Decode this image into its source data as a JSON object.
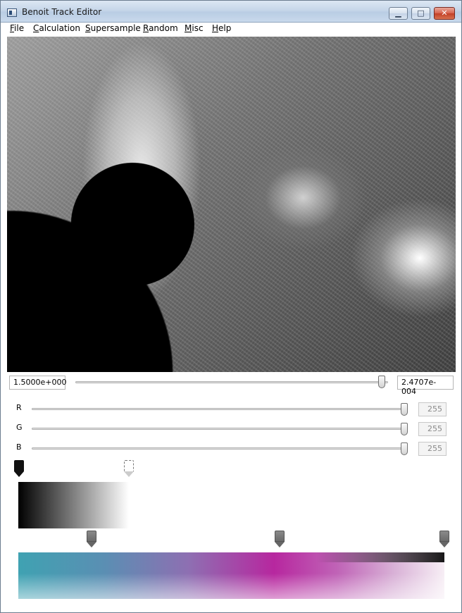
{
  "window": {
    "title": "Benoit Track Editor"
  },
  "menu": [
    "File",
    "Calculation",
    "Supersample",
    "Random",
    "Misc",
    "Help"
  ],
  "zoom": {
    "min_value": "1.5000e+000",
    "max_value": "2.4707e-004",
    "slider_position": 0.99
  },
  "rgb": [
    {
      "label": "R",
      "value": "255",
      "level": 1.0
    },
    {
      "label": "G",
      "value": "255",
      "level": 1.0
    },
    {
      "label": "B",
      "value": "255",
      "level": 1.0
    }
  ],
  "colors": {
    "accent_magenta": "#b7279f",
    "accent_teal": "#3fa2b2"
  }
}
